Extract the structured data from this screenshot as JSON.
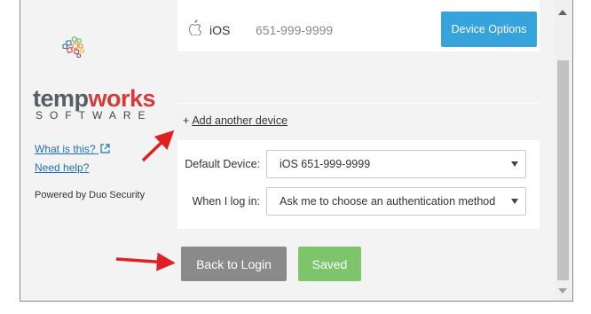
{
  "brand": {
    "name_part1": "temp",
    "name_part2": "works",
    "subtitle": "SOFTWARE"
  },
  "sidebar": {
    "what_is_this": "What is this?",
    "need_help": "Need help?",
    "powered_by": "Powered by Duo Security"
  },
  "device": {
    "os_label": "iOS",
    "phone": "651-999-9999",
    "options_button": "Device Options"
  },
  "add_device": {
    "plus": "+",
    "label": "Add another device"
  },
  "settings": {
    "default_device_label": "Default Device:",
    "default_device_value": "iOS 651-999-9999",
    "login_label": "When I log in:",
    "login_value": "Ask me to choose an authentication method"
  },
  "actions": {
    "back": "Back to Login",
    "saved": "Saved"
  },
  "colors": {
    "accent_blue": "#37a3dd",
    "saved_green": "#7dc46b",
    "back_gray": "#8a8a8a",
    "annotation_red": "#e02020",
    "link_blue": "#1f6fb8"
  },
  "icons": [
    "apple-icon",
    "external-link-icon",
    "chevron-down-icon",
    "annotation-arrow"
  ]
}
